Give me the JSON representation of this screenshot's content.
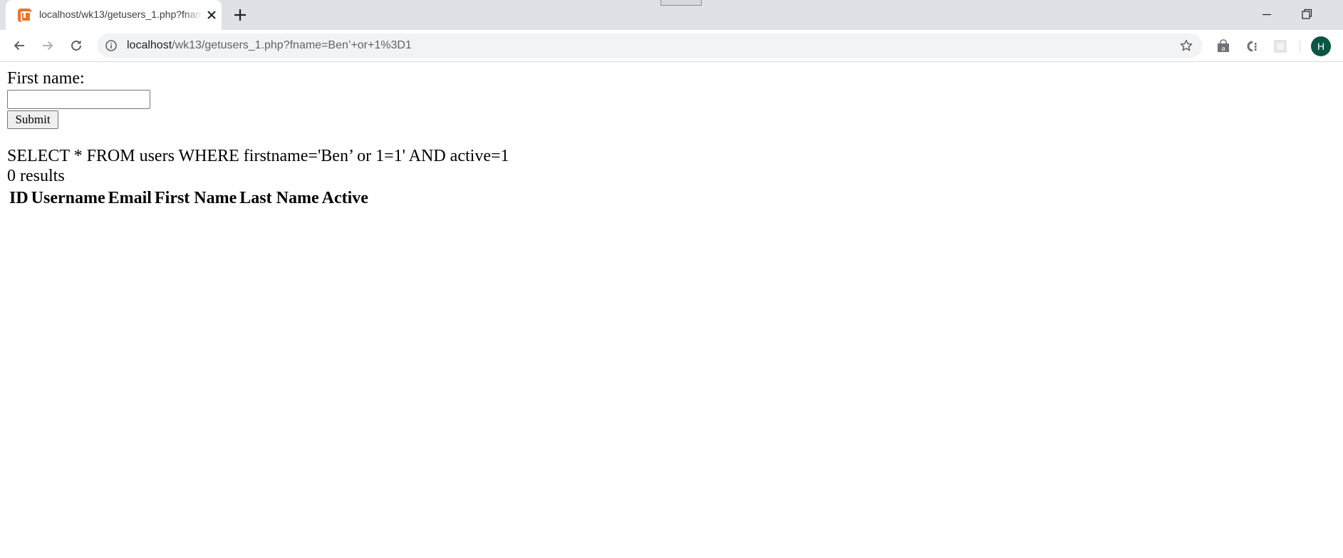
{
  "browser": {
    "tab_title": "localhost/wk13/getusers_1.php?fname=Ben'+or+1%3D1",
    "url_host": "localhost",
    "url_rest": "/wk13/getusers_1.php?fname=Ben’+or+1%3D1",
    "profile_initial": "H",
    "accent_color": "#0a5544",
    "favicon_color": "#e8762d"
  },
  "form": {
    "label": "First name:",
    "input_value": "",
    "submit_label": "Submit"
  },
  "output": {
    "query": "SELECT * FROM users WHERE firstname='Ben’ or 1=1' AND active=1",
    "results": "0 results",
    "columns": [
      "ID",
      "Username",
      "Email",
      "First Name",
      "Last Name",
      "Active"
    ]
  }
}
